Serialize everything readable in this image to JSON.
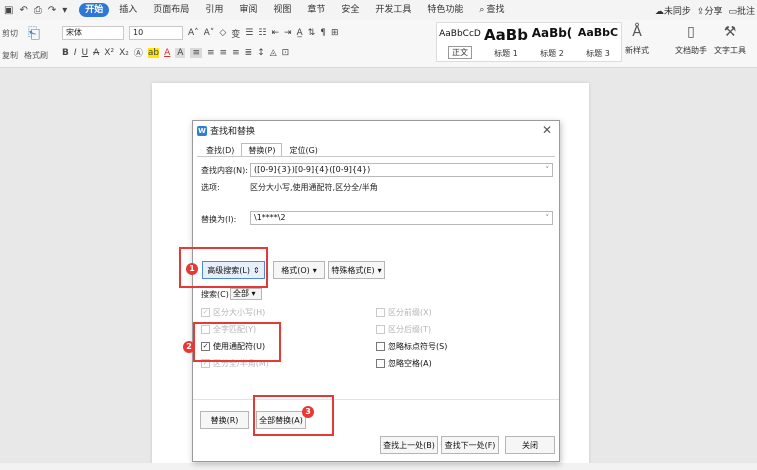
{
  "menubar": {
    "quick_icons": [
      "save-icon",
      "undo-icon",
      "print-icon",
      "redo-icon"
    ],
    "items": [
      "开始",
      "插入",
      "页面布局",
      "引用",
      "审阅",
      "视图",
      "章节",
      "安全",
      "开发工具",
      "特色功能"
    ],
    "search_label": "查找",
    "sync_label": "未同步",
    "share_label": "分享",
    "comment_label": "批注",
    "accent": "#2f78d2"
  },
  "ribbon": {
    "cut_label": "剪切",
    "copy_label": "复制",
    "format_painter_label": "格式刷",
    "font_name": "宋体",
    "font_size": "10",
    "styles": [
      {
        "preview": "AaBbCcD",
        "name": "正文"
      },
      {
        "preview": "AaBb",
        "name": "标题 1"
      },
      {
        "preview": "AaBb(",
        "name": "标题 2"
      },
      {
        "preview": "AaBbC",
        "name": "标题 3"
      }
    ],
    "new_style_label": "新样式",
    "doc_assistant_label": "文档助手",
    "text_tools_label": "文字工具"
  },
  "dialog": {
    "title": "查找和替换",
    "tabs": [
      "查找(D)",
      "替换(P)",
      "定位(G)"
    ],
    "find_label": "查找内容(N):",
    "find_value": "([0-9]{3})[0-9]{4}([0-9]{4})",
    "options_label": "选项:",
    "options_value": "区分大小写,使用通配符,区分全/半角",
    "replace_label": "替换为(I):",
    "replace_value": "\\1****\\2",
    "advanced_search_label": "高级搜索(L)",
    "format_label": "格式(O)",
    "special_format_label": "特殊格式(E)",
    "search_scope_label": "搜索(C)",
    "search_scope_value": "全部",
    "checkboxes_left": [
      {
        "label": "区分大小写(H)",
        "checked": true,
        "disabled": true
      },
      {
        "label": "全字匹配(Y)",
        "checked": false,
        "disabled": true
      },
      {
        "label": "使用通配符(U)",
        "checked": true,
        "disabled": false
      },
      {
        "label": "区分全/半角(M)",
        "checked": true,
        "disabled": true
      }
    ],
    "checkboxes_right": [
      {
        "label": "区分前缀(X)",
        "checked": false,
        "disabled": true
      },
      {
        "label": "区分后缀(T)",
        "checked": false,
        "disabled": true
      },
      {
        "label": "忽略标点符号(S)",
        "checked": false,
        "disabled": false
      },
      {
        "label": "忽略空格(A)",
        "checked": false,
        "disabled": false
      }
    ],
    "replace_button": "替换(R)",
    "replace_all_button": "全部替换(A)",
    "find_prev_button": "查找上一处(B)",
    "find_next_button": "查找下一处(F)",
    "close_button": "关闭"
  },
  "annotations": {
    "color": "#e53935",
    "steps": [
      "1",
      "2",
      "3"
    ]
  }
}
